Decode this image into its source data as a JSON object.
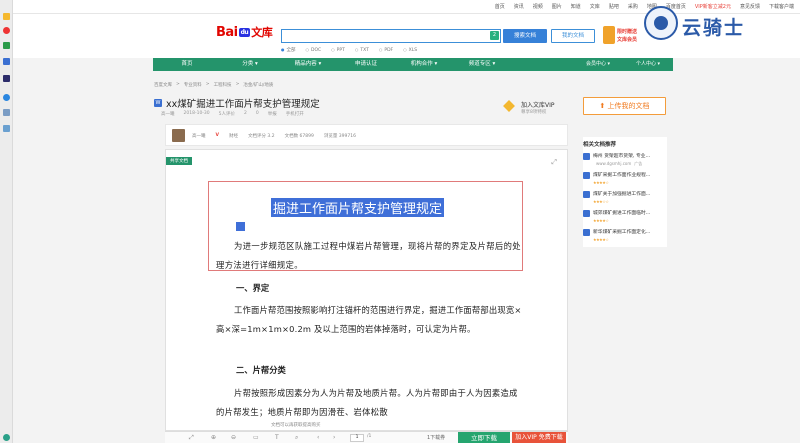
{
  "topbar": {
    "links": [
      "首页",
      "资讯",
      "视频",
      "图片",
      "知道",
      "文库",
      "贴吧",
      "采购",
      "地图",
      "百度首页",
      "VIP新客立减2元",
      "意见反馈",
      "下载客户端"
    ]
  },
  "header": {
    "logo": {
      "bai": "Bai",
      "paw": "du",
      "wenku": "文库"
    },
    "search_count": "2",
    "search_button": "搜索文档",
    "mine_button": "我的文档",
    "filetypes": [
      "全部",
      "DOC",
      "PPT",
      "TXT",
      "PDF",
      "XLS"
    ],
    "promo": {
      "line1": "限时赠送",
      "line2": "文库会员"
    },
    "watermark": "云骑士"
  },
  "nav": {
    "items": [
      "首页",
      "分类 ▾",
      "精品内容 ▾",
      "申请认证",
      "机构合作 ▾",
      "频道专区 ▾"
    ],
    "right": [
      "会员中心 ▾",
      "个人中心 ▾"
    ]
  },
  "breadcrumb": [
    "百度文库",
    "专业资料",
    "工程科技",
    "冶金/矿山/地质"
  ],
  "doc": {
    "type_icon": "W",
    "title": "xx煤矿掘进工作面片帮支护管理规定",
    "meta": [
      "高一曦",
      "2018-10-30",
      "5人评价",
      "2",
      "0",
      "举报",
      "手机打开"
    ]
  },
  "vip_add": {
    "l1": "加入文库VIP",
    "l2": "尊享8项特权"
  },
  "right_panel": {
    "upload_button": "上传我的文档",
    "related_title": "相关文档推荐",
    "items": [
      {
        "title": "梅州 货架超市货架, 专业...",
        "sub": "www.dgsmhj.com",
        "tag": "广告",
        "stars": ""
      },
      {
        "title": "煤矿采掘工作面作业规程...",
        "sub": "",
        "tag": "",
        "stars": "★★★★☆"
      },
      {
        "title": "煤矿关于加强掘进工作面...",
        "sub": "",
        "tag": "",
        "stars": "★★★☆☆"
      },
      {
        "title": "城郊煤矿掘进工作面临时...",
        "sub": "",
        "tag": "",
        "stars": "★★★★☆"
      },
      {
        "title": "新华煤矿采掘工作面定化...",
        "sub": "",
        "tag": "",
        "stars": "★★★★☆"
      }
    ]
  },
  "viewer_head": {
    "author": "高一曦",
    "info": [
      "V",
      "财经",
      "文档评分 3.2",
      "文档数 67899",
      "浏览量 399716"
    ]
  },
  "viewer": {
    "share_tag": "共享文档",
    "expand_icon": "⤢",
    "heading": "掘进工作面片帮支护管理规定",
    "p1": "为进一步规范区队施工过程中煤岩片帮管理，现将片帮的界定及片帮后的处理方法进行详细规定。",
    "sec1": "一、界定",
    "p2": "工作面片帮范围按照影响打注锚杆的范围进行界定，掘进工作面帮部出现宽×高×深=1m×1m×0.2m 及以上范围的岩体掉落时，可认定为片帮。",
    "sec2": "二、片帮分类",
    "p3": "片帮按照形成因素分为人为片帮及地质片帮。人为片帮即由于人为因素造成的片帮发生；地质片帮即为因滑茬、岩体松散",
    "cut_note": "文档可以再获取提高购买"
  },
  "toolbar": {
    "page_input": "1",
    "page_total": "/1",
    "download_count": "1下载券",
    "download_button": "立即下载",
    "vip_button": "加入VIP 免费下载"
  }
}
